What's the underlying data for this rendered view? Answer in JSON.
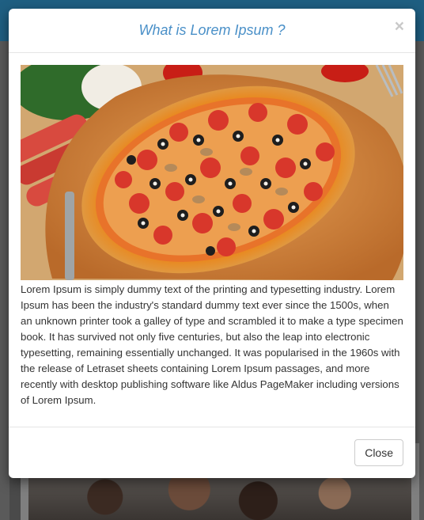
{
  "modal": {
    "title": "What is Lorem Ipsum ?",
    "close_icon_glyph": "×",
    "close_icon_name": "close-icon",
    "image_subject": "pizza",
    "body_text": "Lorem Ipsum is simply dummy text of the printing and typesetting industry. Lorem Ipsum has been the industry's standard dummy text ever since the 1500s, when an unknown printer took a galley of type and scrambled it to make a type specimen book. It has survived not only five centuries, but also the leap into electronic typesetting, remaining essentially unchanged. It was popularised in the 1960s with the release of Letraset sheets containing Lorem Ipsum passages, and more recently with desktop publishing software like Aldus PageMaker including versions of Lorem Ipsum.",
    "footer": {
      "close_label": "Close"
    }
  },
  "colors": {
    "title": "#4a90c8",
    "close_icon": "#c9c9c9",
    "text": "#333333",
    "backdrop_header": "#1f5f82"
  }
}
